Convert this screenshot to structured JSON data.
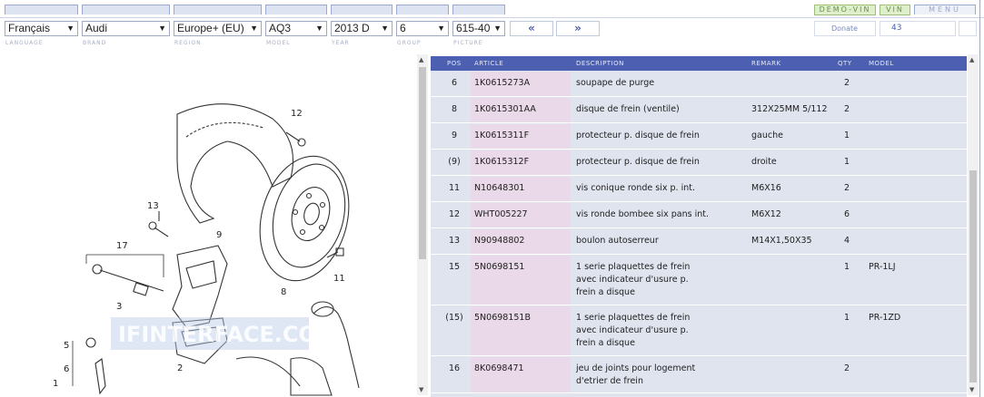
{
  "top_buttons": {
    "demo": "DEMO-VIN",
    "vin": "VIN",
    "menu": "MENU"
  },
  "selectors": {
    "language": "Français",
    "brand": "Audi",
    "region": "Europe+ (EU)",
    "model": "AQ3",
    "year": "2013  D",
    "group": "6",
    "picture": "615-40"
  },
  "nav": {
    "prev": "«",
    "next": "»"
  },
  "donate": "Donate",
  "counter": "43",
  "labels": {
    "language": "LANGUAGE",
    "brand": "BRAND",
    "region": "REGION",
    "model": "MODEL",
    "year": "YEAR",
    "group": "GROUP",
    "picture": "PICTURE"
  },
  "watermark": "IFINTERFACE.COM",
  "diagram_numbers": [
    "12",
    "13",
    "9",
    "17",
    "8",
    "11",
    "3",
    "2",
    "5",
    "6",
    "1"
  ],
  "table": {
    "headers": {
      "pos": "POS",
      "article": "ARTICLE",
      "description": "DESCRIPTION",
      "remark": "REMARK",
      "qty": "QTY",
      "model": "MODEL"
    },
    "rows": [
      {
        "pos": "6",
        "article": "1K0615273A",
        "description": [
          "soupape de purge"
        ],
        "remark": "",
        "qty": "2",
        "model": ""
      },
      {
        "pos": "8",
        "article": "1K0615301AA",
        "description": [
          "disque de frein (ventile)"
        ],
        "remark": "312X25MM 5/112",
        "qty": "2",
        "model": ""
      },
      {
        "pos": "9",
        "article": "1K0615311F",
        "description": [
          "protecteur p. disque de frein"
        ],
        "remark": "gauche",
        "qty": "1",
        "model": ""
      },
      {
        "pos": "(9)",
        "article": "1K0615312F",
        "description": [
          "protecteur p. disque de frein"
        ],
        "remark": "droite",
        "qty": "1",
        "model": ""
      },
      {
        "pos": "11",
        "article": "N10648301",
        "description": [
          "vis conique ronde six p. int."
        ],
        "remark": "M6X16",
        "qty": "2",
        "model": ""
      },
      {
        "pos": "12",
        "article": "WHT005227",
        "description": [
          "vis ronde bombee six pans int."
        ],
        "remark": "M6X12",
        "qty": "6",
        "model": ""
      },
      {
        "pos": "13",
        "article": "N90948802",
        "description": [
          "boulon autoserreur"
        ],
        "remark": "M14X1,50X35",
        "qty": "4",
        "model": ""
      },
      {
        "pos": "15",
        "article": "5N0698151",
        "description": [
          "1 serie plaquettes de frein",
          "avec indicateur d'usure p.",
          "frein a disque"
        ],
        "remark": "",
        "qty": "1",
        "model": "PR-1LJ"
      },
      {
        "pos": "(15)",
        "article": "5N0698151B",
        "description": [
          "1 serie plaquettes de frein",
          "avec indicateur d'usure p.",
          "frein a disque"
        ],
        "remark": "",
        "qty": "1",
        "model": "PR-1ZD"
      },
      {
        "pos": "16",
        "article": "8K0698471",
        "description": [
          "jeu de joints pour logement",
          "d'etrier de frein"
        ],
        "remark": "",
        "qty": "2",
        "model": ""
      }
    ]
  }
}
